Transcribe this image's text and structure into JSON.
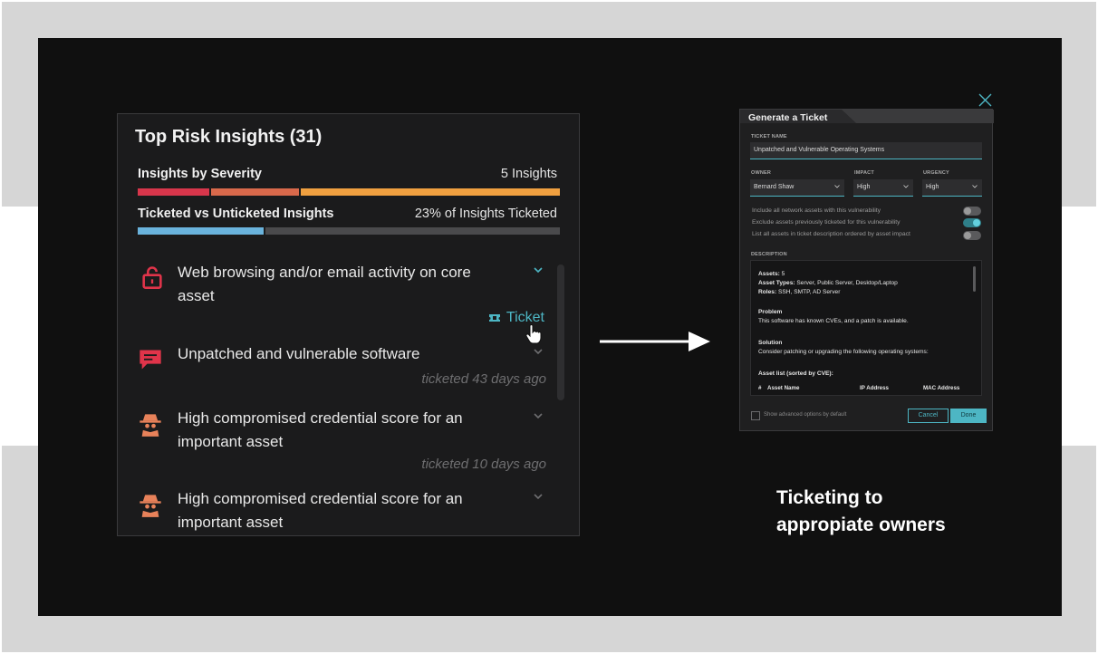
{
  "panel": {
    "title": "Top Risk Insights (31)",
    "severity_label": "Insights by Severity",
    "severity_value": "5 Insights",
    "ticketed_label": "Ticketed vs Unticketed Insights",
    "ticketed_value": "23% of Insights Ticketed",
    "severity_bar": [
      {
        "fraction": 0.17,
        "color": "#d8364b"
      },
      {
        "fraction": 0.21,
        "color": "#d9694b"
      },
      {
        "fraction": 0.62,
        "color": "#f0a040"
      }
    ],
    "ticketed_bar": [
      {
        "fraction": 0.3,
        "color": "#6ab3dc"
      },
      {
        "fraction": 0.7,
        "color": "#4a4a4c"
      }
    ],
    "insights": [
      {
        "text": "Web browsing and/or email activity on core asset",
        "icon": "unlock-icon",
        "meta": "",
        "action": "Ticket"
      },
      {
        "text": "Unpatched and vulnerable software",
        "icon": "message-icon",
        "meta": "ticketed 43 days ago"
      },
      {
        "text": "High compromised credential score for an important asset",
        "icon": "spy-icon",
        "meta": "ticketed 10 days ago"
      },
      {
        "text": "High compromised credential score for an important asset",
        "icon": "spy-icon",
        "meta": ""
      }
    ]
  },
  "dialog": {
    "title": "Generate a Ticket",
    "ticket_name_label": "TICKET NAME",
    "ticket_name_value": "Unpatched and Vulnerable Operating Systems",
    "owner_label": "OWNER",
    "owner_value": "Bernard Shaw",
    "impact_label": "IMPACT",
    "impact_value": "High",
    "urgency_label": "URGENCY",
    "urgency_value": "High",
    "options": [
      {
        "label": "Include all network assets with this vulnerability",
        "on": false
      },
      {
        "label": "Exclude assets previously ticketed for this vulnerability",
        "on": true
      },
      {
        "label": "List all assets in ticket description ordered by asset impact",
        "on": false
      }
    ],
    "description_label": "DESCRIPTION",
    "description": {
      "assets_key": "Assets:",
      "assets_val": " 5",
      "types_key": "Asset Types:",
      "types_val": " Server, Public Server, Desktop/Laptop",
      "roles_key": "Roles:",
      "roles_val": " SSH, SMTP, AD Server",
      "problem_head": "Problem",
      "problem_text": "This software has known CVEs, and a patch is available.",
      "solution_head": "Solution",
      "solution_text": "Consider patching or upgrading the following operating systems:",
      "asset_list_head": "Asset list (sorted by CVE):",
      "col_num": "#",
      "col_name": "Asset Name",
      "col_ip": "IP Address",
      "col_mac": "MAC Address"
    },
    "advanced_label": "Show advanced options by default",
    "cancel_label": "Cancel",
    "done_label": "Done"
  },
  "caption": {
    "line1": "Ticketing to",
    "line2": "appropiate owners"
  },
  "colors": {
    "accent": "#4db6c4",
    "icon_red": "#e0344a",
    "icon_orange": "#e8825a"
  }
}
